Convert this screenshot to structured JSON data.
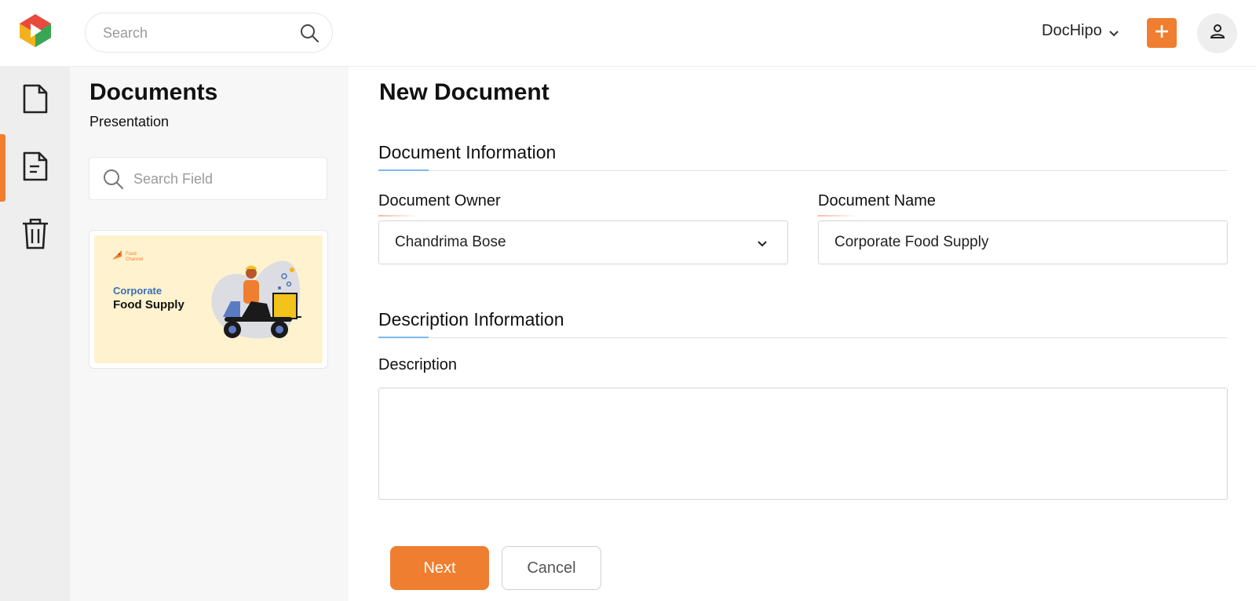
{
  "topbar": {
    "search_placeholder": "Search",
    "account_name": "DocHipo",
    "icons": {
      "logo": "dochipo-logo",
      "search": "search-icon",
      "account_dropdown": "chevron-down-icon",
      "create": "plus-icon",
      "user": "user-icon"
    }
  },
  "rail": {
    "items": [
      {
        "icon": "document-icon",
        "active": false
      },
      {
        "icon": "document-text-icon",
        "active": true
      },
      {
        "icon": "trash-icon",
        "active": false
      }
    ]
  },
  "documents_panel": {
    "title": "Documents",
    "subtitle": "Presentation",
    "search_placeholder": "Search Field",
    "template": {
      "brand_text": "Food Channel",
      "line1": "Corporate",
      "line2": "Food Supply"
    }
  },
  "main": {
    "title": "New Document",
    "document_info": {
      "section_title": "Document Information",
      "owner_label": "Document Owner",
      "owner_value": "Chandrima Bose",
      "name_label": "Document Name",
      "name_value": "Corporate Food Supply"
    },
    "description_info": {
      "section_title": "Description Information",
      "description_label": "Description",
      "description_value": ""
    },
    "buttons": {
      "next": "Next",
      "cancel": "Cancel"
    }
  },
  "colors": {
    "accent": "#f07e30",
    "section_accent": "#7cb9ee",
    "rail_bg": "#eeeeee",
    "panel_bg": "#f7f7f7",
    "template_bg": "#fff2cf"
  }
}
